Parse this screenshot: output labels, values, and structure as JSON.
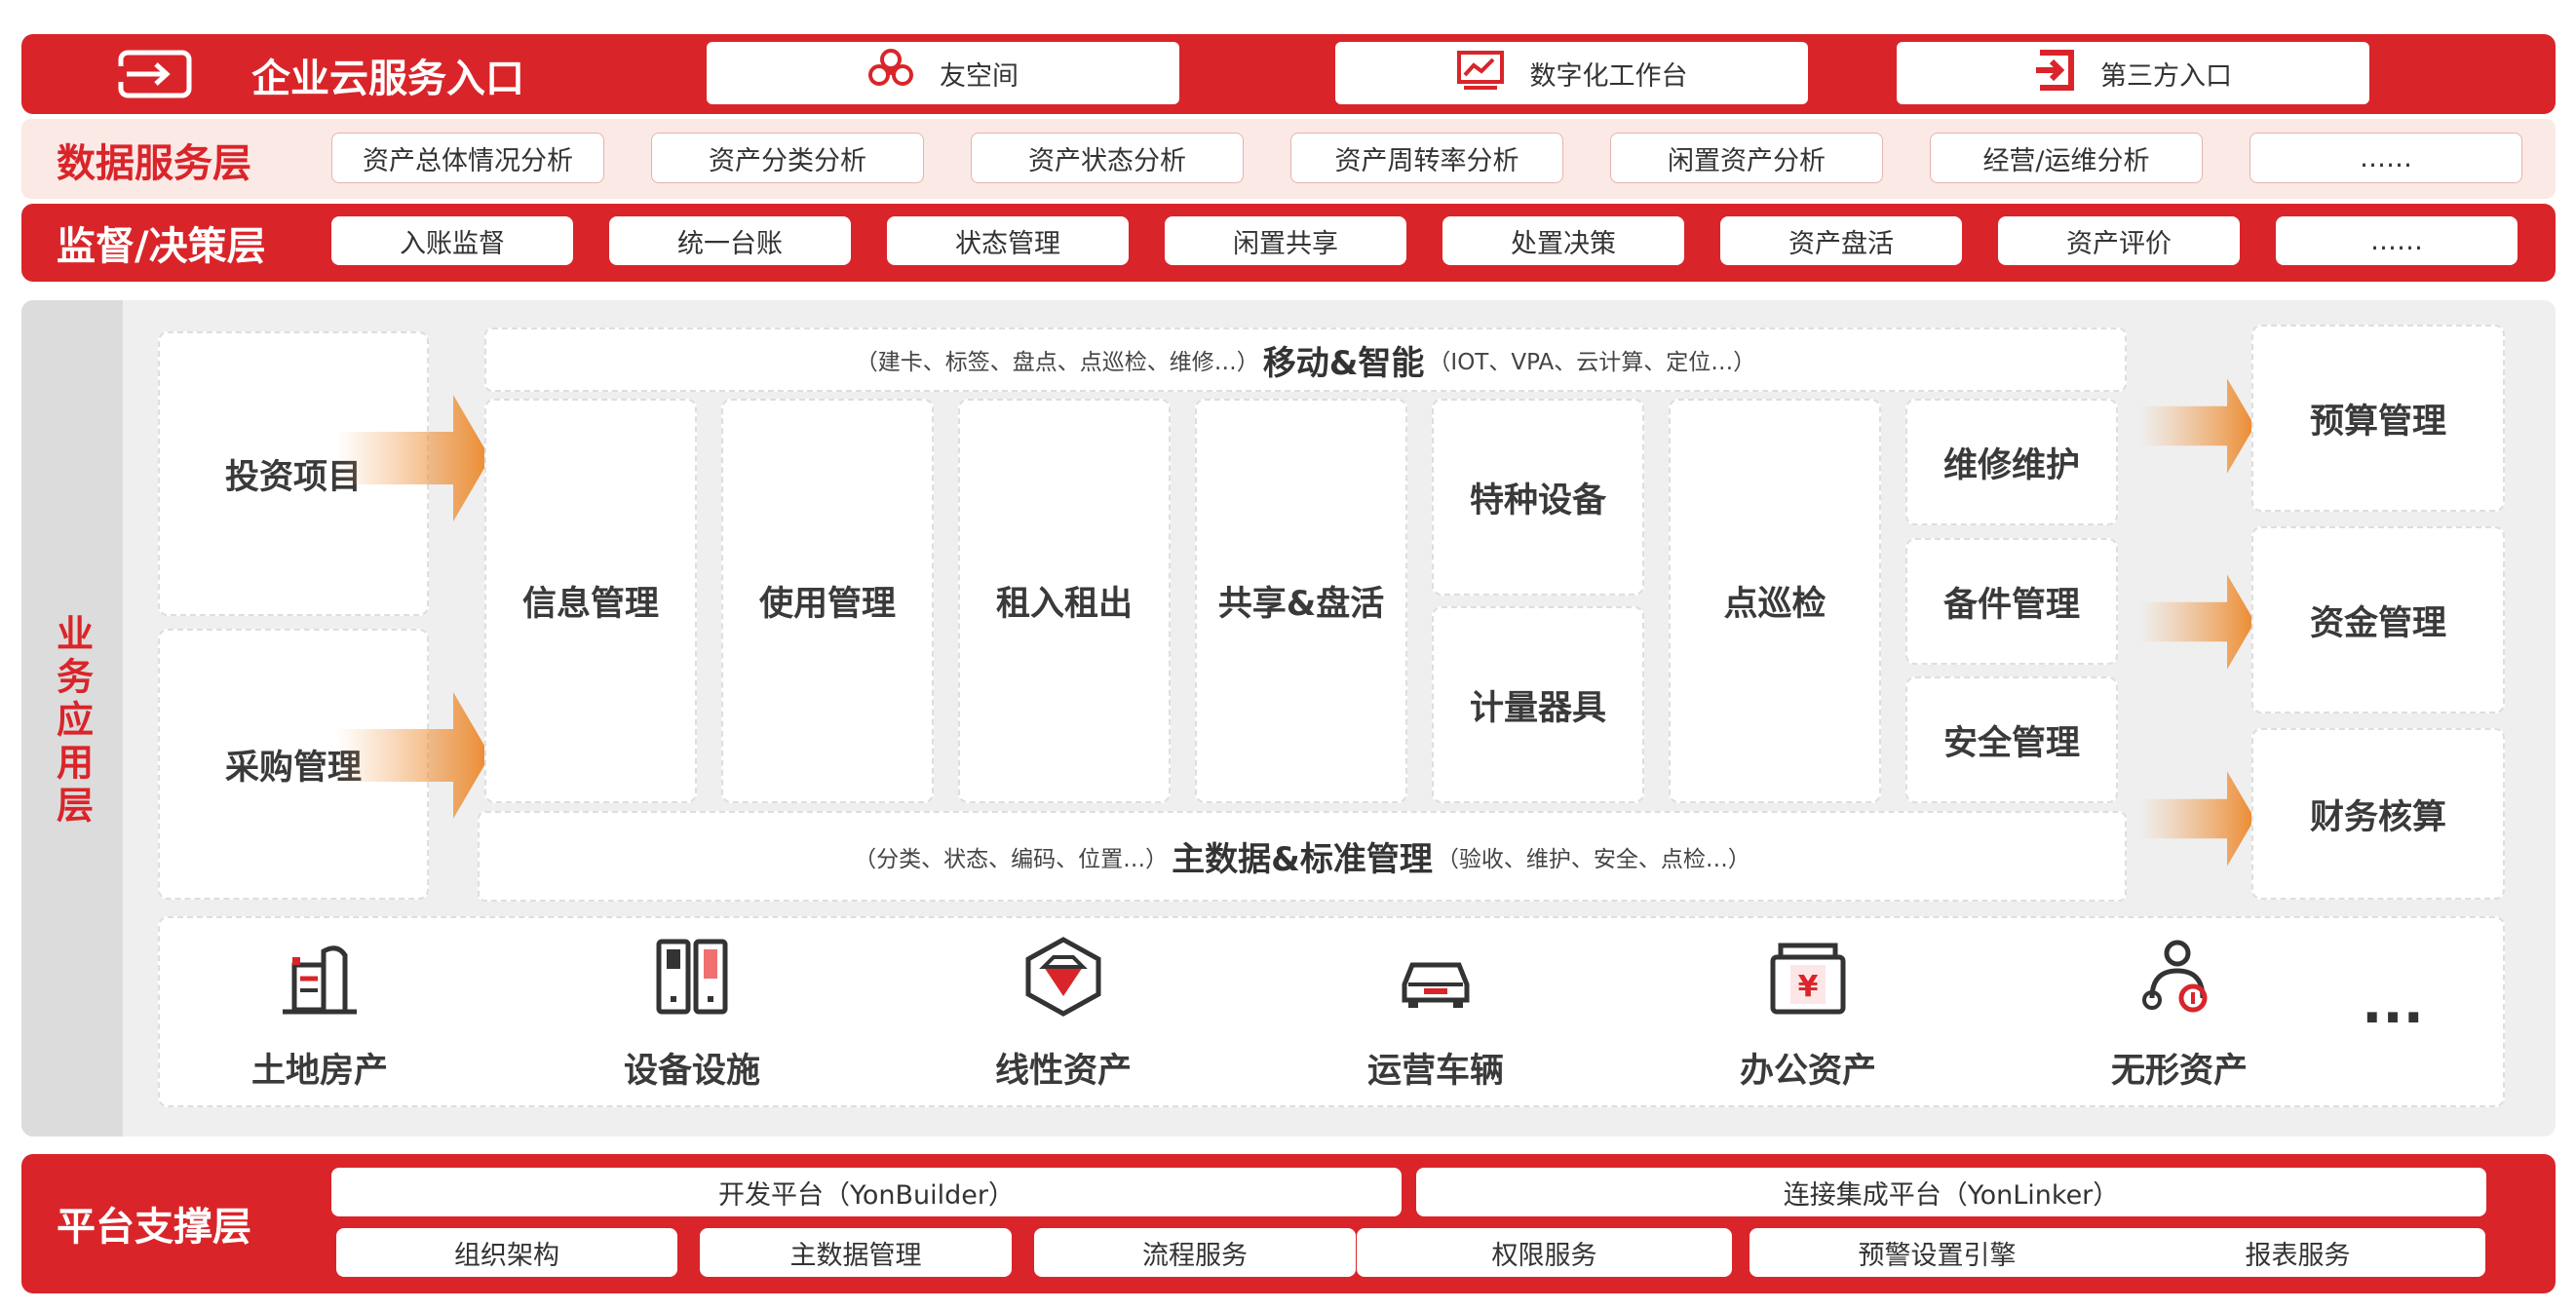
{
  "portal": {
    "title": "企业云服务入口",
    "items": [
      {
        "label": "友空间",
        "icon": "flower-logo-icon"
      },
      {
        "label": "数字化工作台",
        "icon": "monitor-chart-icon"
      },
      {
        "label": "第三方入口",
        "icon": "login-arrow-icon"
      }
    ]
  },
  "data_layer": {
    "title": "数据服务层",
    "items": [
      "资产总体情况分析",
      "资产分类分析",
      "资产状态分析",
      "资产周转率分析",
      "闲置资产分析",
      "经营/运维分析",
      "……"
    ]
  },
  "decision_layer": {
    "title": "监督/决策层",
    "items": [
      "入账监督",
      "统一台账",
      "状态管理",
      "闲置共享",
      "处置决策",
      "资产盘活",
      "资产评价",
      "……"
    ]
  },
  "business_layer": {
    "side_label": "业务应用层",
    "inputs": [
      "投资项目",
      "采购管理"
    ],
    "mobile": {
      "left": "（建卡、标签、盘点、点巡检、维修…）",
      "main": "移动&智能",
      "right": "（IOT、VPA、云计算、定位…）"
    },
    "modules": {
      "info": "信息管理",
      "use": "使用管理",
      "rent": "租入租出",
      "share": "共享&盘活",
      "special": "特种设备",
      "metering": "计量器具",
      "inspection": "点巡检",
      "maintenance": "维修维护",
      "spares": "备件管理",
      "safety": "安全管理"
    },
    "master": {
      "left": "（分类、状态、编码、位置…）",
      "main": "主数据&标准管理",
      "right": "（验收、维护、安全、点检…）"
    },
    "outputs": [
      "预算管理",
      "资金管理",
      "财务核算"
    ],
    "assets": [
      {
        "label": "土地房产",
        "icon": "building-icon"
      },
      {
        "label": "设备设施",
        "icon": "equipment-icon"
      },
      {
        "label": "线性资产",
        "icon": "gem-icon"
      },
      {
        "label": "运营车辆",
        "icon": "car-icon"
      },
      {
        "label": "办公资产",
        "icon": "yuan-box-icon"
      },
      {
        "label": "无形资产",
        "icon": "person-network-icon"
      }
    ],
    "assets_more": "···"
  },
  "platform_layer": {
    "title": "平台支撑层",
    "top": [
      "开发平台（YonBuilder）",
      "连接集成平台（YonLinker）"
    ],
    "bottom": [
      "组织架构",
      "主数据管理",
      "流程服务",
      "权限服务",
      "预警设置引擎",
      "报表服务"
    ]
  },
  "colors": {
    "brand_red": "#d9252a",
    "pink": "#fbe9e6",
    "arrow_orange": "#f0a35a"
  }
}
